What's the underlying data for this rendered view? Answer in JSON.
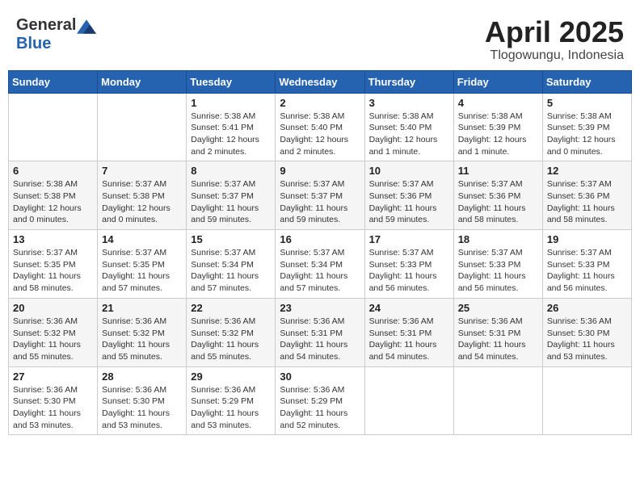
{
  "header": {
    "logo_general": "General",
    "logo_blue": "Blue",
    "month_title": "April 2025",
    "location": "Tlogowungu, Indonesia"
  },
  "weekdays": [
    "Sunday",
    "Monday",
    "Tuesday",
    "Wednesday",
    "Thursday",
    "Friday",
    "Saturday"
  ],
  "weeks": [
    [
      {
        "day": null,
        "info": null
      },
      {
        "day": null,
        "info": null
      },
      {
        "day": "1",
        "sunrise": "Sunrise: 5:38 AM",
        "sunset": "Sunset: 5:41 PM",
        "daylight": "Daylight: 12 hours and 2 minutes."
      },
      {
        "day": "2",
        "sunrise": "Sunrise: 5:38 AM",
        "sunset": "Sunset: 5:40 PM",
        "daylight": "Daylight: 12 hours and 2 minutes."
      },
      {
        "day": "3",
        "sunrise": "Sunrise: 5:38 AM",
        "sunset": "Sunset: 5:40 PM",
        "daylight": "Daylight: 12 hours and 1 minute."
      },
      {
        "day": "4",
        "sunrise": "Sunrise: 5:38 AM",
        "sunset": "Sunset: 5:39 PM",
        "daylight": "Daylight: 12 hours and 1 minute."
      },
      {
        "day": "5",
        "sunrise": "Sunrise: 5:38 AM",
        "sunset": "Sunset: 5:39 PM",
        "daylight": "Daylight: 12 hours and 0 minutes."
      }
    ],
    [
      {
        "day": "6",
        "sunrise": "Sunrise: 5:38 AM",
        "sunset": "Sunset: 5:38 PM",
        "daylight": "Daylight: 12 hours and 0 minutes."
      },
      {
        "day": "7",
        "sunrise": "Sunrise: 5:37 AM",
        "sunset": "Sunset: 5:38 PM",
        "daylight": "Daylight: 12 hours and 0 minutes."
      },
      {
        "day": "8",
        "sunrise": "Sunrise: 5:37 AM",
        "sunset": "Sunset: 5:37 PM",
        "daylight": "Daylight: 11 hours and 59 minutes."
      },
      {
        "day": "9",
        "sunrise": "Sunrise: 5:37 AM",
        "sunset": "Sunset: 5:37 PM",
        "daylight": "Daylight: 11 hours and 59 minutes."
      },
      {
        "day": "10",
        "sunrise": "Sunrise: 5:37 AM",
        "sunset": "Sunset: 5:36 PM",
        "daylight": "Daylight: 11 hours and 59 minutes."
      },
      {
        "day": "11",
        "sunrise": "Sunrise: 5:37 AM",
        "sunset": "Sunset: 5:36 PM",
        "daylight": "Daylight: 11 hours and 58 minutes."
      },
      {
        "day": "12",
        "sunrise": "Sunrise: 5:37 AM",
        "sunset": "Sunset: 5:36 PM",
        "daylight": "Daylight: 11 hours and 58 minutes."
      }
    ],
    [
      {
        "day": "13",
        "sunrise": "Sunrise: 5:37 AM",
        "sunset": "Sunset: 5:35 PM",
        "daylight": "Daylight: 11 hours and 58 minutes."
      },
      {
        "day": "14",
        "sunrise": "Sunrise: 5:37 AM",
        "sunset": "Sunset: 5:35 PM",
        "daylight": "Daylight: 11 hours and 57 minutes."
      },
      {
        "day": "15",
        "sunrise": "Sunrise: 5:37 AM",
        "sunset": "Sunset: 5:34 PM",
        "daylight": "Daylight: 11 hours and 57 minutes."
      },
      {
        "day": "16",
        "sunrise": "Sunrise: 5:37 AM",
        "sunset": "Sunset: 5:34 PM",
        "daylight": "Daylight: 11 hours and 57 minutes."
      },
      {
        "day": "17",
        "sunrise": "Sunrise: 5:37 AM",
        "sunset": "Sunset: 5:33 PM",
        "daylight": "Daylight: 11 hours and 56 minutes."
      },
      {
        "day": "18",
        "sunrise": "Sunrise: 5:37 AM",
        "sunset": "Sunset: 5:33 PM",
        "daylight": "Daylight: 11 hours and 56 minutes."
      },
      {
        "day": "19",
        "sunrise": "Sunrise: 5:37 AM",
        "sunset": "Sunset: 5:33 PM",
        "daylight": "Daylight: 11 hours and 56 minutes."
      }
    ],
    [
      {
        "day": "20",
        "sunrise": "Sunrise: 5:36 AM",
        "sunset": "Sunset: 5:32 PM",
        "daylight": "Daylight: 11 hours and 55 minutes."
      },
      {
        "day": "21",
        "sunrise": "Sunrise: 5:36 AM",
        "sunset": "Sunset: 5:32 PM",
        "daylight": "Daylight: 11 hours and 55 minutes."
      },
      {
        "day": "22",
        "sunrise": "Sunrise: 5:36 AM",
        "sunset": "Sunset: 5:32 PM",
        "daylight": "Daylight: 11 hours and 55 minutes."
      },
      {
        "day": "23",
        "sunrise": "Sunrise: 5:36 AM",
        "sunset": "Sunset: 5:31 PM",
        "daylight": "Daylight: 11 hours and 54 minutes."
      },
      {
        "day": "24",
        "sunrise": "Sunrise: 5:36 AM",
        "sunset": "Sunset: 5:31 PM",
        "daylight": "Daylight: 11 hours and 54 minutes."
      },
      {
        "day": "25",
        "sunrise": "Sunrise: 5:36 AM",
        "sunset": "Sunset: 5:31 PM",
        "daylight": "Daylight: 11 hours and 54 minutes."
      },
      {
        "day": "26",
        "sunrise": "Sunrise: 5:36 AM",
        "sunset": "Sunset: 5:30 PM",
        "daylight": "Daylight: 11 hours and 53 minutes."
      }
    ],
    [
      {
        "day": "27",
        "sunrise": "Sunrise: 5:36 AM",
        "sunset": "Sunset: 5:30 PM",
        "daylight": "Daylight: 11 hours and 53 minutes."
      },
      {
        "day": "28",
        "sunrise": "Sunrise: 5:36 AM",
        "sunset": "Sunset: 5:30 PM",
        "daylight": "Daylight: 11 hours and 53 minutes."
      },
      {
        "day": "29",
        "sunrise": "Sunrise: 5:36 AM",
        "sunset": "Sunset: 5:29 PM",
        "daylight": "Daylight: 11 hours and 53 minutes."
      },
      {
        "day": "30",
        "sunrise": "Sunrise: 5:36 AM",
        "sunset": "Sunset: 5:29 PM",
        "daylight": "Daylight: 11 hours and 52 minutes."
      },
      {
        "day": null,
        "info": null
      },
      {
        "day": null,
        "info": null
      },
      {
        "day": null,
        "info": null
      }
    ]
  ]
}
